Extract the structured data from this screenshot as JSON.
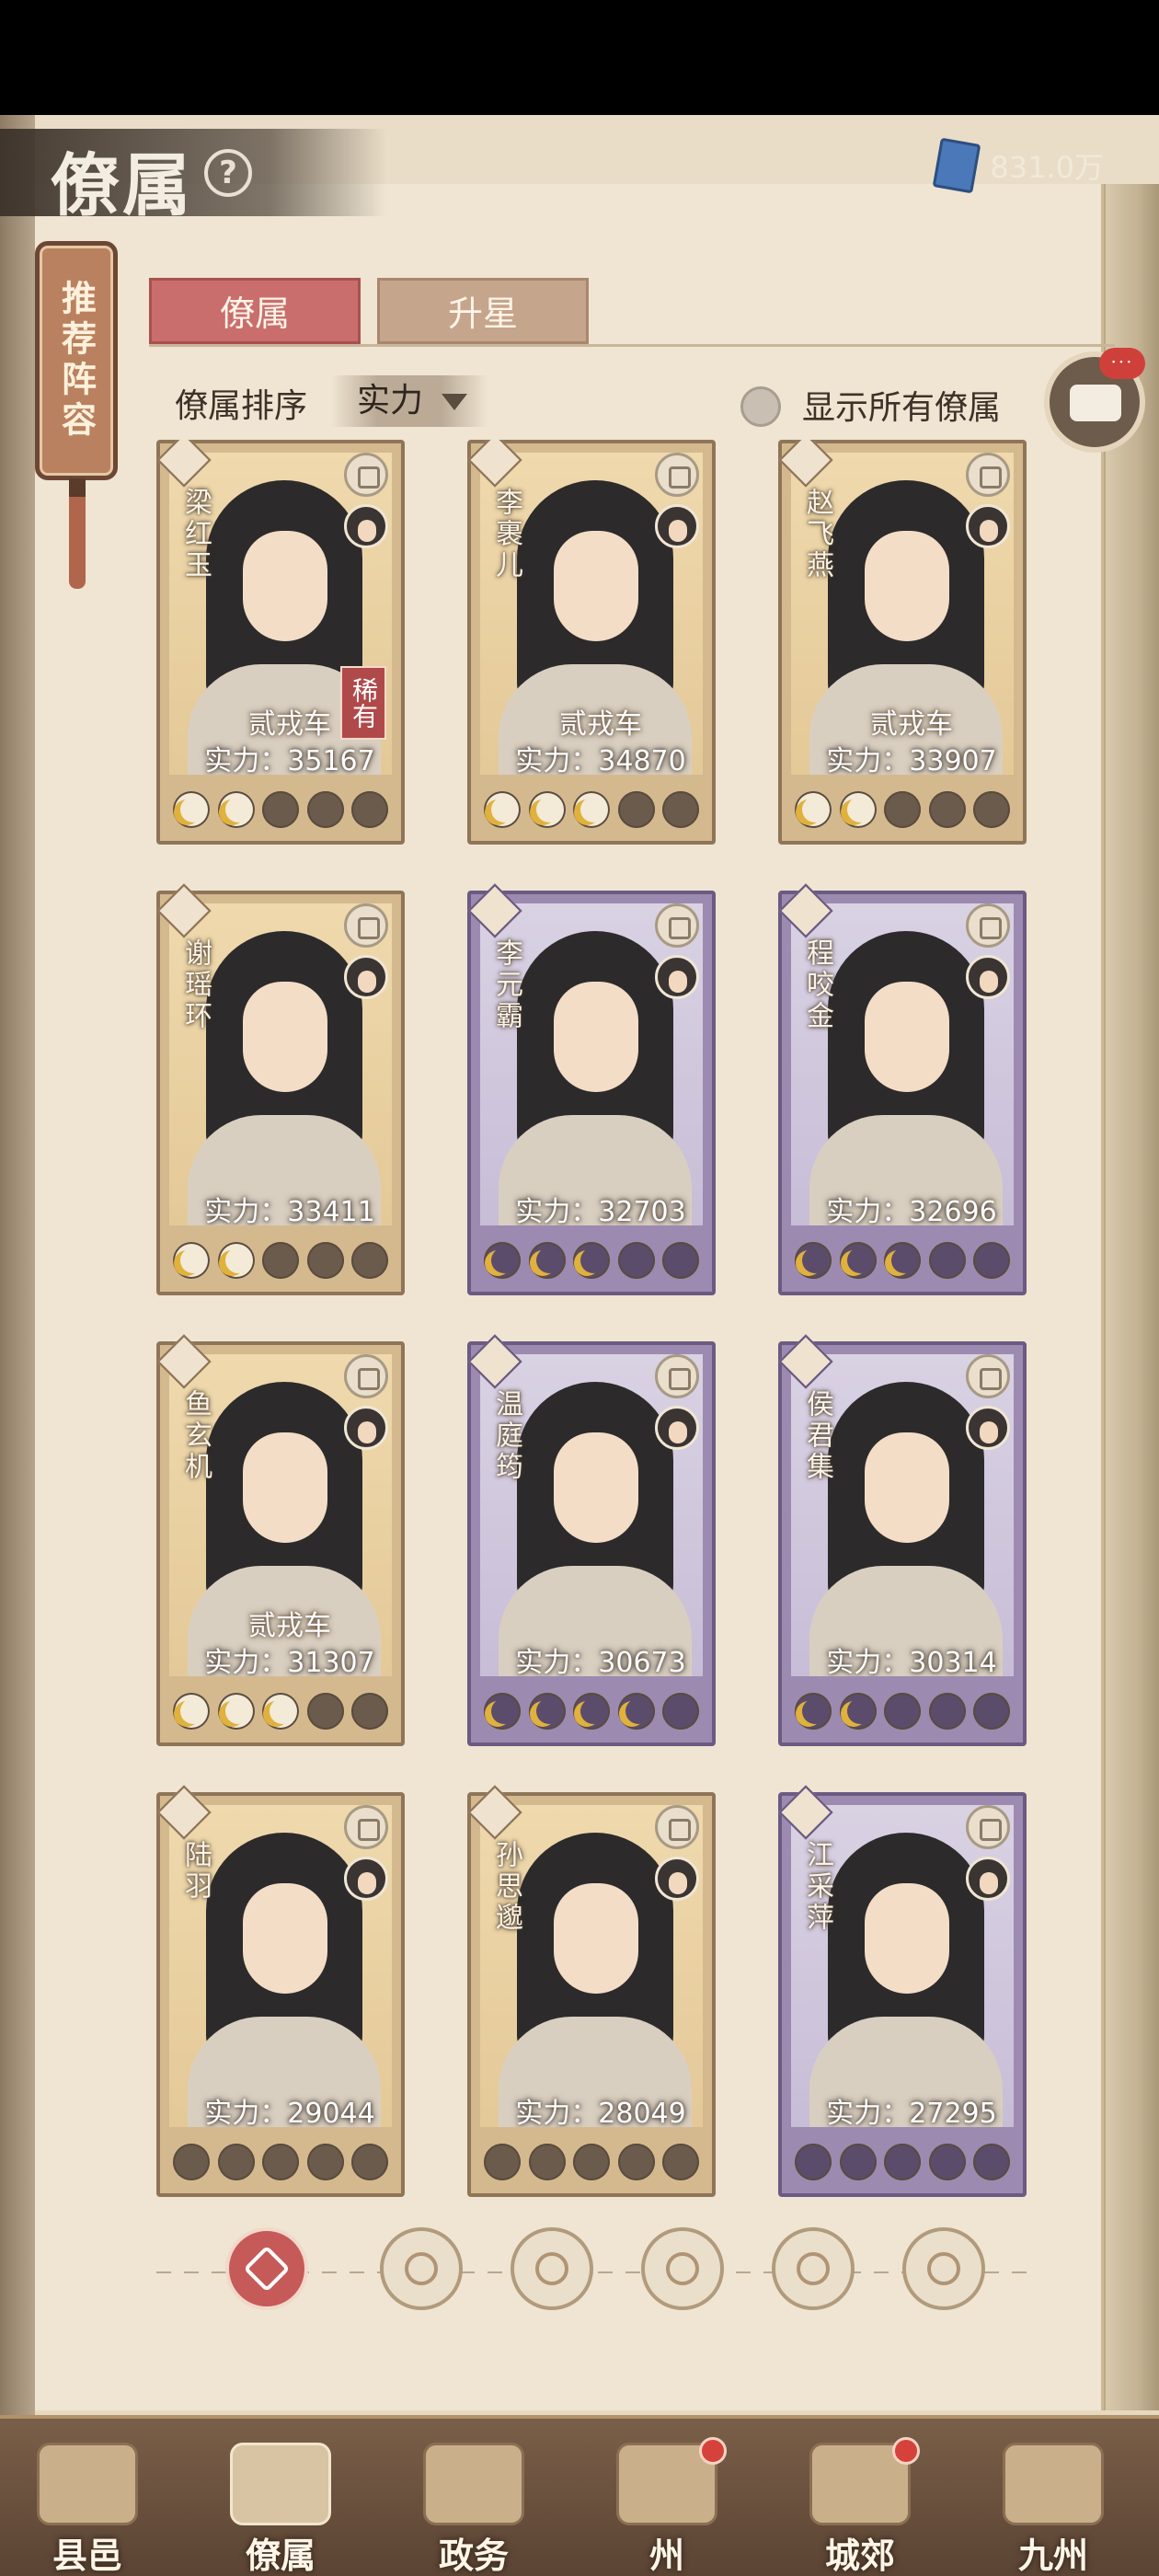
{
  "header": {
    "title": "僚属",
    "help_symbol": "?",
    "currency_value": "831.0万"
  },
  "recommend_tab": {
    "label": "推荐阵容"
  },
  "tabs": [
    {
      "label": "僚属",
      "active": true
    },
    {
      "label": "升星",
      "active": false
    }
  ],
  "sort": {
    "label": "僚属排序",
    "selected": "实力"
  },
  "show_all": {
    "label": "显示所有僚属",
    "checked": false
  },
  "chat": {
    "badge": "···"
  },
  "power_prefix": "实力：",
  "cards": [
    {
      "name": "梁红玉",
      "rank": "贰戎车",
      "badge": "稀有",
      "power": "35167",
      "stars_lit": 2,
      "stars_total": 5,
      "frame": "gold"
    },
    {
      "name": "李裹儿",
      "rank": "贰戎车",
      "badge": "",
      "power": "34870",
      "stars_lit": 3,
      "stars_total": 5,
      "frame": "gold"
    },
    {
      "name": "赵飞燕",
      "rank": "贰戎车",
      "badge": "",
      "power": "33907",
      "stars_lit": 2,
      "stars_total": 5,
      "frame": "gold"
    },
    {
      "name": "谢瑶环",
      "rank": "",
      "badge": "",
      "power": "33411",
      "stars_lit": 2,
      "stars_total": 5,
      "frame": "gold"
    },
    {
      "name": "李元霸",
      "rank": "",
      "badge": "",
      "power": "32703",
      "stars_lit": 3,
      "stars_total": 5,
      "frame": "purple"
    },
    {
      "name": "程咬金",
      "rank": "",
      "badge": "",
      "power": "32696",
      "stars_lit": 3,
      "stars_total": 5,
      "frame": "purple"
    },
    {
      "name": "鱼玄机",
      "rank": "贰戎车",
      "badge": "",
      "power": "31307",
      "stars_lit": 3,
      "stars_total": 5,
      "frame": "gold"
    },
    {
      "name": "温庭筠",
      "rank": "",
      "badge": "",
      "power": "30673",
      "stars_lit": 4,
      "stars_total": 5,
      "frame": "purple"
    },
    {
      "name": "侯君集",
      "rank": "",
      "badge": "",
      "power": "30314",
      "stars_lit": 2,
      "stars_total": 5,
      "frame": "purple"
    },
    {
      "name": "陆羽",
      "rank": "",
      "badge": "",
      "power": "29044",
      "stars_lit": 0,
      "stars_total": 5,
      "frame": "gold"
    },
    {
      "name": "孙思邈",
      "rank": "",
      "badge": "",
      "power": "28049",
      "stars_lit": 0,
      "stars_total": 5,
      "frame": "gold"
    },
    {
      "name": "江采萍",
      "rank": "",
      "badge": "",
      "power": "27295",
      "stars_lit": 0,
      "stars_total": 5,
      "frame": "purple"
    }
  ],
  "filters": [
    {
      "icon": "all-filter-icon",
      "active": true
    },
    {
      "icon": "soldier-filter-icon",
      "active": false
    },
    {
      "icon": "gourd-filter-icon",
      "active": false
    },
    {
      "icon": "fan-filter-icon",
      "active": false
    },
    {
      "icon": "beast-filter-icon",
      "active": false
    },
    {
      "icon": "leaf-filter-icon",
      "active": false
    }
  ],
  "nav": [
    {
      "label": "县邑",
      "dot": false,
      "active": false
    },
    {
      "label": "僚属",
      "dot": false,
      "active": true
    },
    {
      "label": "政务",
      "dot": false,
      "active": false
    },
    {
      "label": "州",
      "dot": true,
      "active": false
    },
    {
      "label": "城郊",
      "dot": true,
      "active": false
    },
    {
      "label": "九州",
      "dot": false,
      "active": false
    }
  ]
}
